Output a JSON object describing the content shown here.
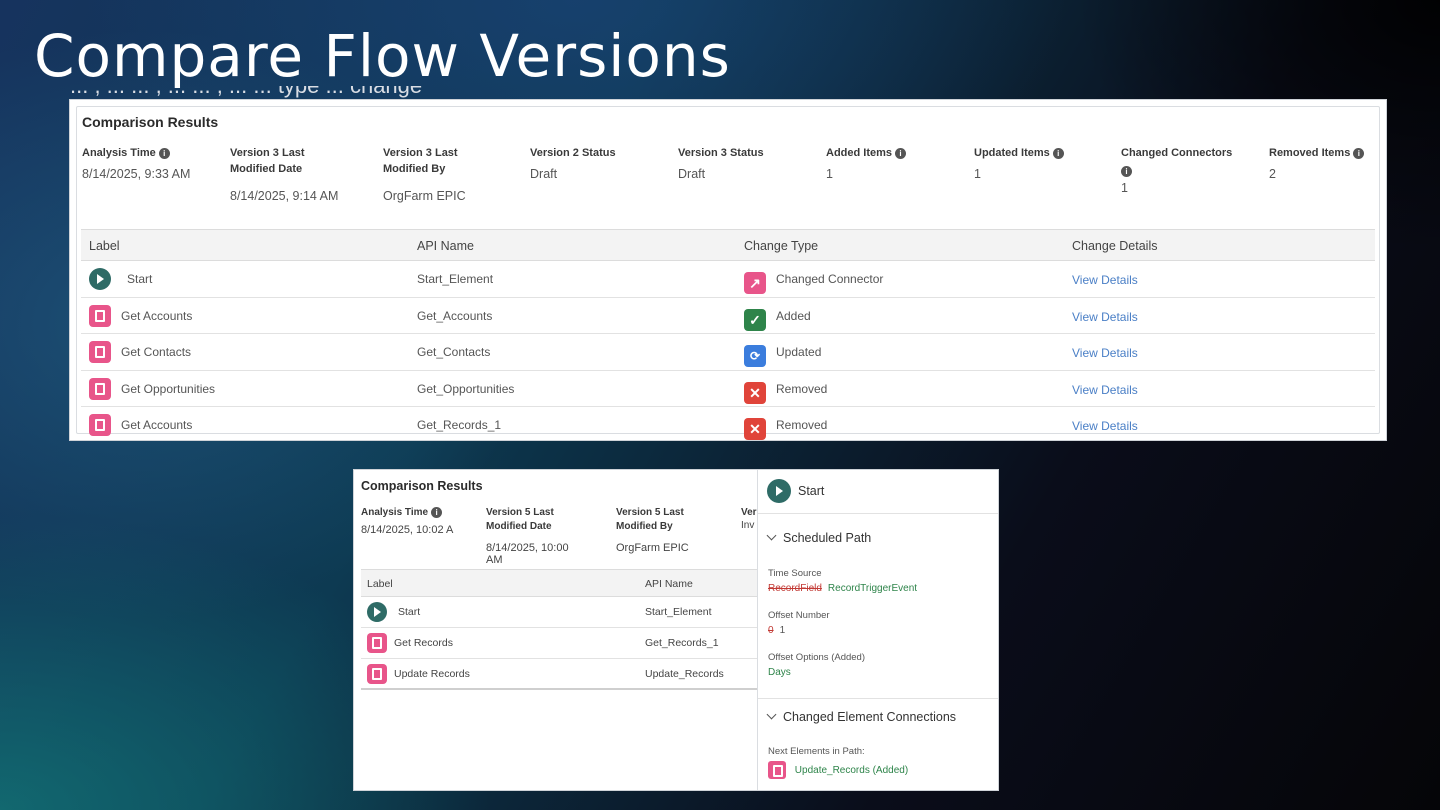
{
  "slide": {
    "title": "Compare Flow Versions",
    "cut_text": "... , ... ... , ... ... , ... ... type ... change"
  },
  "panel1": {
    "title": "Comparison Results",
    "meta": [
      {
        "label": "Analysis Time",
        "info": true,
        "value": "8/14/2025, 9:33 AM"
      },
      {
        "label": "Version 3 Last Modified Date",
        "info": false,
        "value": "8/14/2025, 9:14 AM"
      },
      {
        "label": "Version 3 Last Modified By",
        "info": false,
        "value": "OrgFarm EPIC"
      },
      {
        "label": "Version 2 Status",
        "info": false,
        "value": "Draft"
      },
      {
        "label": "Version 3 Status",
        "info": false,
        "value": "Draft"
      },
      {
        "label": "Added Items",
        "info": true,
        "value": "1"
      },
      {
        "label": "Updated Items",
        "info": true,
        "value": "1"
      },
      {
        "label": "Changed Connectors",
        "info": true,
        "value": "1"
      },
      {
        "label": "Removed Items",
        "info": true,
        "value": "2"
      }
    ],
    "columns": [
      "Label",
      "API Name",
      "Change Type",
      "Change Details"
    ],
    "rows": [
      {
        "label": "Start",
        "icon": "start-icon",
        "api": "Start_Element",
        "change": "Changed Connector",
        "change_icon": "connector-icon",
        "details": "View Details"
      },
      {
        "label": "Get Accounts",
        "icon": "get-records-icon",
        "api": "Get_Accounts",
        "change": "Added",
        "change_icon": "added-check-icon",
        "details": "View Details"
      },
      {
        "label": "Get Contacts",
        "icon": "get-records-icon",
        "api": "Get_Contacts",
        "change": "Updated",
        "change_icon": "updated-icon",
        "details": "View Details"
      },
      {
        "label": "Get Opportunities",
        "icon": "get-records-icon",
        "api": "Get_Opportunities",
        "change": "Removed",
        "change_icon": "removed-x-icon",
        "details": "View Details"
      },
      {
        "label": "Get Accounts",
        "icon": "get-records-icon",
        "api": "Get_Records_1",
        "change": "Removed",
        "change_icon": "removed-x-icon",
        "details": "View Details"
      }
    ],
    "colors": {
      "connector": "#e8558a",
      "added": "#2e844a",
      "updated": "#3b7ddd",
      "removed": "#e0443a",
      "link": "#4a7fc6"
    }
  },
  "panel2": {
    "title": "Comparison Results",
    "meta": [
      {
        "label": "Analysis Time",
        "value": "8/14/2025, 10:02 A"
      },
      {
        "label": "Version 5 Last Modified Date",
        "value": "8/14/2025, 10:00 AM"
      },
      {
        "label": "Version 5 Last Modified By",
        "value": "OrgFarm EPIC"
      },
      {
        "label": "Ver",
        "value": "Inv"
      }
    ],
    "columns": [
      "Label",
      "API Name"
    ],
    "rows": [
      {
        "label": "Start",
        "api": "Start_Element"
      },
      {
        "label": "Get Records",
        "api": "Get_Records_1"
      },
      {
        "label": "Update Records",
        "api": "Update_Records"
      }
    ],
    "side": {
      "header": "Start",
      "section1": "Scheduled Path",
      "time_source_label": "Time Source",
      "time_source_old": "RecordField",
      "time_source_new": "RecordTriggerEvent",
      "offset_number_label": "Offset Number",
      "offset_number_old": "0",
      "offset_number_new": "1",
      "offset_options_label": "Offset Options (Added)",
      "offset_options_value": "Days",
      "section2": "Changed Element Connections",
      "next_label": "Next Elements in Path:",
      "next_value": "Update_Records (Added)"
    }
  }
}
